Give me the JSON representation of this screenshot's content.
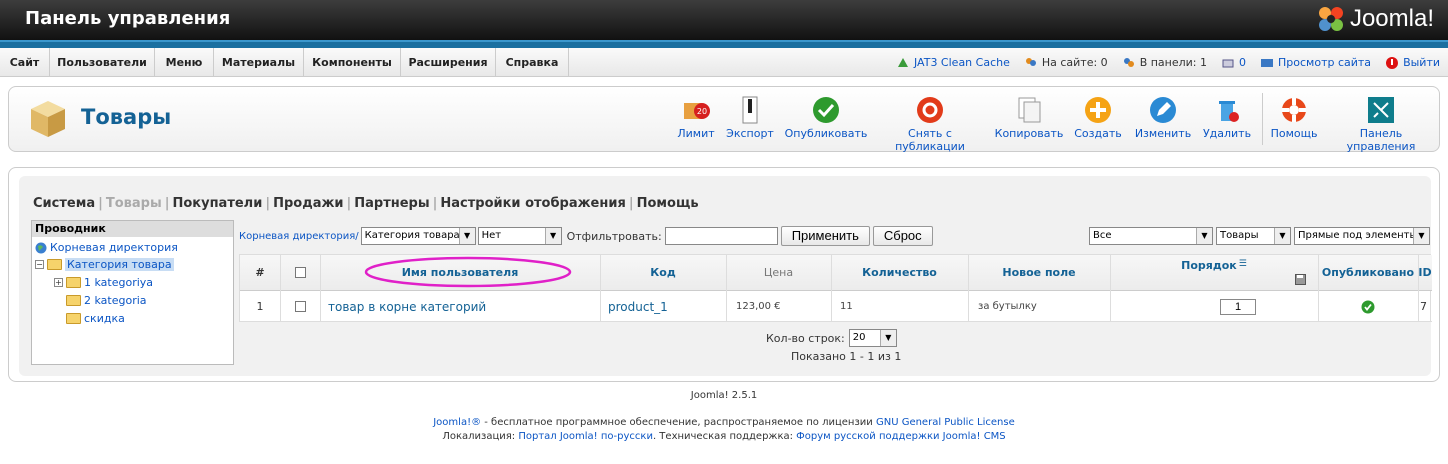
{
  "header": {
    "title": "Панель управления",
    "logo_text": "Joomla!"
  },
  "menu": {
    "items": [
      "Сайт",
      "Пользователи",
      "Меню",
      "Материалы",
      "Компоненты",
      "Расширения",
      "Справка"
    ]
  },
  "status": {
    "cache": "JAT3 Clean Cache",
    "on_site": "На сайте: 0",
    "in_panel": "В панели: 1",
    "messages": "0",
    "preview": "Просмотр сайта",
    "logout": "Выйти"
  },
  "toolbar": {
    "page_title": "Товары",
    "buttons": [
      "Лимит",
      "Экспорт",
      "Опубликовать",
      "Снять с публикации",
      "Копировать",
      "Создать",
      "Изменить",
      "Удалить",
      "Помощь",
      "Панель управления"
    ],
    "limit_badge": "20"
  },
  "subnav": {
    "items": [
      "Система",
      "Товары",
      "Покупатели",
      "Продажи",
      "Партнеры",
      "Настройки отображения",
      "Помощь"
    ]
  },
  "tree": {
    "header": "Проводник",
    "root": "Корневая директория",
    "category": "Категория товара",
    "children": [
      "1 kategoriya",
      "2 kategoria",
      "скидка"
    ]
  },
  "filters": {
    "path": "Корневая директория/",
    "category_select": "Категория товара",
    "none_select": "Нет",
    "filter_label": "Отфильтровать:",
    "filter_value": "",
    "apply": "Применить",
    "reset": "Сброс",
    "all_select": "Все",
    "products_select": "Товары",
    "direct_select": "Прямые под элементы"
  },
  "table": {
    "headers": {
      "num": "#",
      "name": "Имя пользователя",
      "code": "Код",
      "price": "Цена",
      "qty": "Количество",
      "newfield": "Новое поле",
      "order": "Порядок",
      "published": "Опубликовано",
      "id": "ID"
    },
    "rows": [
      {
        "num": "1",
        "name": "товар в корне категорий",
        "code": "product_1",
        "price": "123,00 €",
        "qty": "11",
        "newfield": "за бутылку",
        "order": "1",
        "id": "7"
      }
    ]
  },
  "pagination": {
    "label": "Кол-во строк:",
    "value": "20",
    "shown": "Показано 1 - 1 из 1"
  },
  "footer": {
    "version": "Joomla! 2.5.1",
    "line1_link1": "Joomla!®",
    "line1_text": " - бесплатное программное обеспечение, распространяемое по лицензии ",
    "line1_link2": "GNU General Public License",
    "line2_text1": "Локализация: ",
    "line2_link1": "Портал Joomla! по-русски",
    "line2_text2": ". Техническая поддержка: ",
    "line2_link2": "Форум русской поддержки Joomla! CMS"
  },
  "colors": {
    "accent": "#146295",
    "link": "#0b55c4",
    "blue_bar": "#1a6fa0",
    "highlight_ellipse": "#e020c8"
  }
}
